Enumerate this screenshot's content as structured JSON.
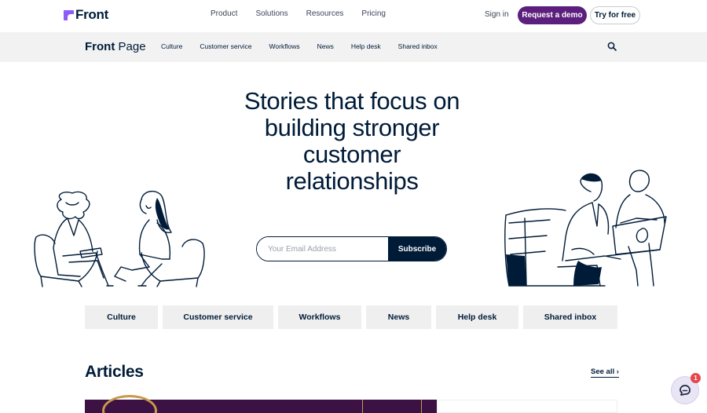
{
  "topnav": {
    "logo_text": "Front",
    "links": [
      "Product",
      "Solutions",
      "Resources",
      "Pricing"
    ],
    "signin": "Sign in",
    "request_demo": "Request a demo",
    "try_free": "Try for free"
  },
  "subnav": {
    "logo_bold": "Front",
    "logo_light": "Page",
    "links": [
      "Culture",
      "Customer service",
      "Workflows",
      "News",
      "Help desk",
      "Shared inbox"
    ]
  },
  "hero": {
    "title": "Stories that focus on building stronger customer relationships",
    "email_placeholder": "Your Email Address",
    "subscribe_label": "Subscribe"
  },
  "categories": [
    "Culture",
    "Customer service",
    "Workflows",
    "News",
    "Help desk",
    "Shared inbox"
  ],
  "articles": {
    "heading": "Articles",
    "see_all": "See all ›"
  },
  "chat": {
    "badge_count": "1"
  },
  "colors": {
    "brand_purple": "#5c1f7d",
    "logo_purple": "#8b5cf6",
    "navy": "#001b38",
    "badge_red": "#e5484d"
  }
}
